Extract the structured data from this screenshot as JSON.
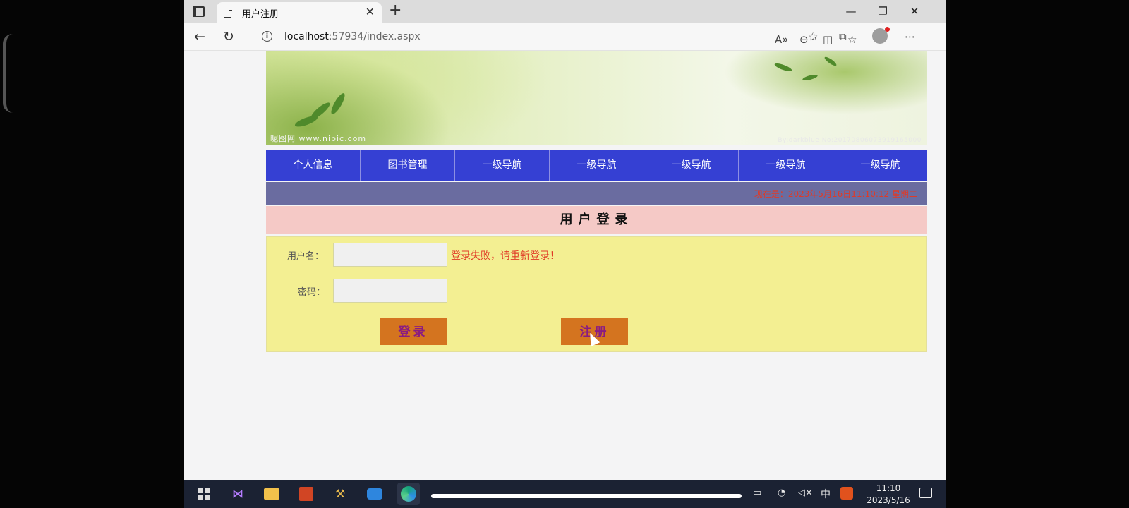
{
  "browser": {
    "tab_title": "用户注册",
    "url_host": "localhost",
    "url_rest": ":57934/index.aspx"
  },
  "banner": {
    "caption": "昵图网 www.nipic.com",
    "right_caption": "By:darkblue No:20170806073919165000"
  },
  "nav": {
    "items": [
      "个人信息",
      "图书管理",
      "一级导航",
      "一级导航",
      "一级导航",
      "一级导航",
      "一级导航"
    ]
  },
  "date_bar": {
    "text": "现在是：2023年5月16日11:10:12 星期二"
  },
  "login": {
    "title": "用户登录",
    "username_label": "用户名：",
    "password_label": "密码：",
    "error": "登录失败，请重新登录！",
    "login_button": "登录",
    "register_button": "注册"
  },
  "taskbar": {
    "clock_time": "11:10",
    "clock_date": "2023/5/16",
    "ime": "中"
  },
  "icons": {
    "back": "back-arrow-icon",
    "refresh": "refresh-icon",
    "info": "info-icon",
    "read_aloud": "read-aloud-icon",
    "zoom_out": "zoom-out-icon",
    "split": "split-screen-icon",
    "favorite_add": "favorite-add-icon",
    "favorites": "favorites-icon",
    "collections": "collections-icon",
    "menu": "more-menu-icon"
  },
  "colors": {
    "nav_bg": "#3540d3",
    "date_bar_bg": "#6a6ca0",
    "date_text": "#e03a26",
    "login_title_bg": "#f5c9c6",
    "login_panel_bg": "#f3ef92",
    "button_bg": "#d4741f",
    "button_text": "#8a1c82"
  }
}
